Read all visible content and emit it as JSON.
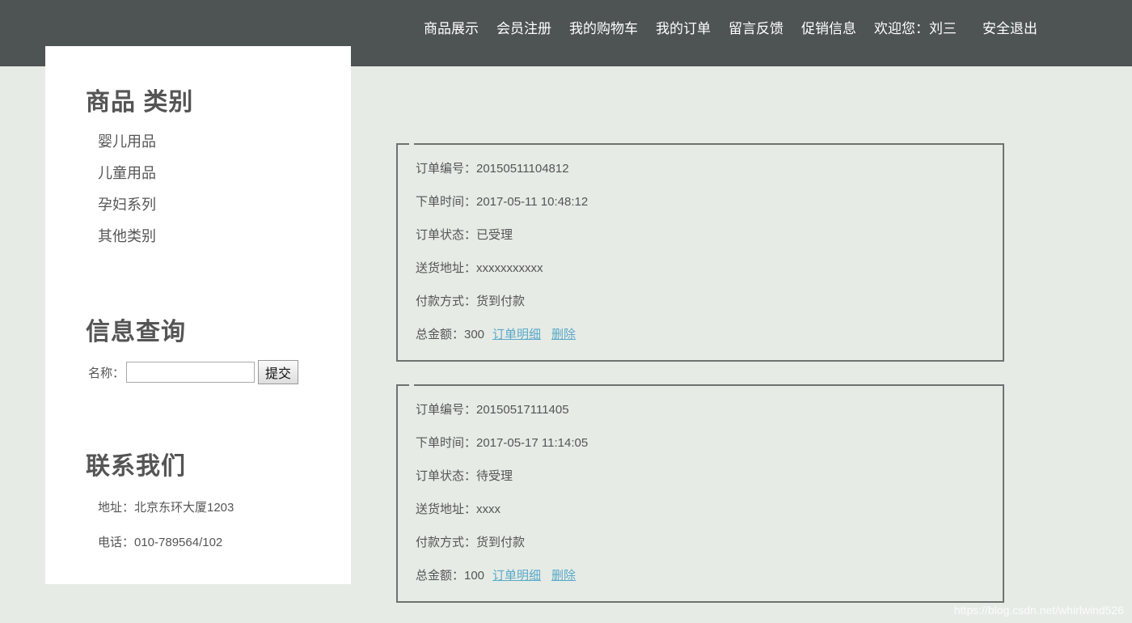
{
  "nav": {
    "items": [
      "商品展示",
      "会员注册",
      "我的购物车",
      "我的订单",
      "留言反馈",
      "促销信息"
    ],
    "welcome": "欢迎您：刘三",
    "logout": "安全退出"
  },
  "sidebar": {
    "categories_title": "商品 类别",
    "categories": [
      "婴儿用品",
      "儿童用品",
      "孕妇系列",
      "其他类别"
    ],
    "search_title": "信息查询",
    "search_label": "名称：",
    "search_value": "",
    "submit_label": "提交",
    "contact_title": "联系我们",
    "address": "地址：北京东环大厦1203",
    "phone": "电话：010-789564/102"
  },
  "orders": [
    {
      "number": "订单编号：20150511104812",
      "time": "下单时间：2017-05-11 10:48:12",
      "status": "订单状态：已受理",
      "address": "送货地址：xxxxxxxxxxx",
      "payment": "付款方式：货到付款",
      "total": "总金额：300",
      "detail_link": "订单明细",
      "delete_link": "删除"
    },
    {
      "number": "订单编号：20150517111405",
      "time": "下单时间：2017-05-17 11:14:05",
      "status": "订单状态：待受理",
      "address": "送货地址：xxxx",
      "payment": "付款方式：货到付款",
      "total": "总金额：100",
      "detail_link": "订单明细",
      "delete_link": "删除"
    }
  ],
  "watermark": "https://blog.csdn.net/whirlwind526",
  "colors": {
    "topbar": "#4e5354",
    "background": "#e6ebe6",
    "link": "#5aa9c8",
    "border": "#6e7270"
  }
}
